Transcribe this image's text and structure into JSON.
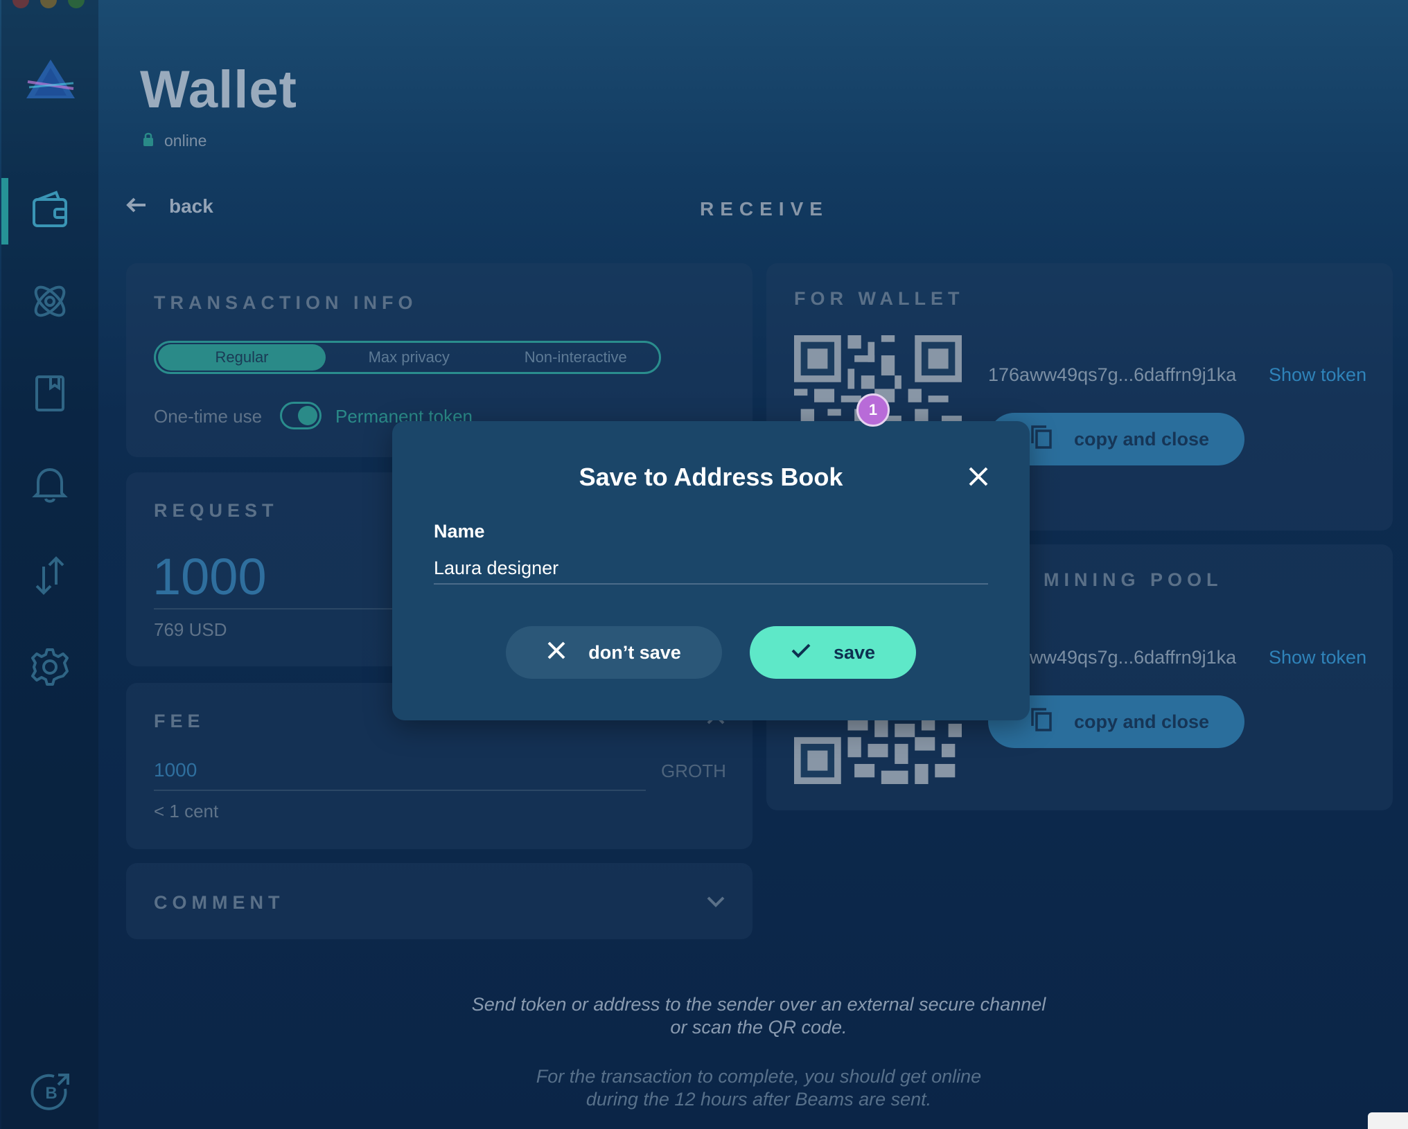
{
  "window": {
    "controls": [
      "close",
      "minimize",
      "maximize"
    ]
  },
  "header": {
    "title": "Wallet",
    "status": "online"
  },
  "nav": {
    "back_label": "back",
    "screen_title": "RECEIVE"
  },
  "sidebar": {
    "items": [
      {
        "icon": "wallet-icon",
        "active": true
      },
      {
        "icon": "atom-icon",
        "active": false
      },
      {
        "icon": "address-book-icon",
        "active": false
      },
      {
        "icon": "bell-icon",
        "active": false
      },
      {
        "icon": "swap-icon",
        "active": false
      },
      {
        "icon": "gear-icon",
        "active": false
      }
    ],
    "bottom_icon": "beam-external-icon"
  },
  "transaction_info": {
    "title": "TRANSACTION INFO",
    "types": [
      "Regular",
      "Max privacy",
      "Non-interactive"
    ],
    "selected_type": "Regular",
    "one_time_label": "One-time use",
    "permanent_label": "Permanent token"
  },
  "request": {
    "title": "REQUEST",
    "amount": "1000",
    "usd": "769 USD"
  },
  "fee": {
    "title": "FEE",
    "amount": "1000",
    "unit": "GROTH",
    "usd": "< 1 cent"
  },
  "comment": {
    "title": "COMMENT"
  },
  "for_wallet": {
    "title": "FOR WALLET",
    "address": "176aww49qs7g...6daffrn9j1ka",
    "show_token": "Show token",
    "copy_label": "copy and close"
  },
  "mining_pool": {
    "title": "MINING POOL",
    "address": "ww49qs7g...6daffrn9j1ka",
    "show_token": "Show token",
    "copy_label": "copy and close"
  },
  "hints": {
    "line1": "Send token or address to the sender over an external secure channel",
    "line2": "or scan the QR code.",
    "line3": "For the transaction to complete, you should get online",
    "line4": "during the 12 hours after Beams are sent."
  },
  "badge": {
    "count": "1"
  },
  "modal": {
    "title": "Save to Address Book",
    "name_label": "Name",
    "name_value": "Laura designer",
    "dont_save_label": "don’t save",
    "save_label": "save"
  },
  "colors": {
    "accent": "#5ee8c8",
    "badge": "#b86bd8",
    "link": "#2f83b9"
  }
}
